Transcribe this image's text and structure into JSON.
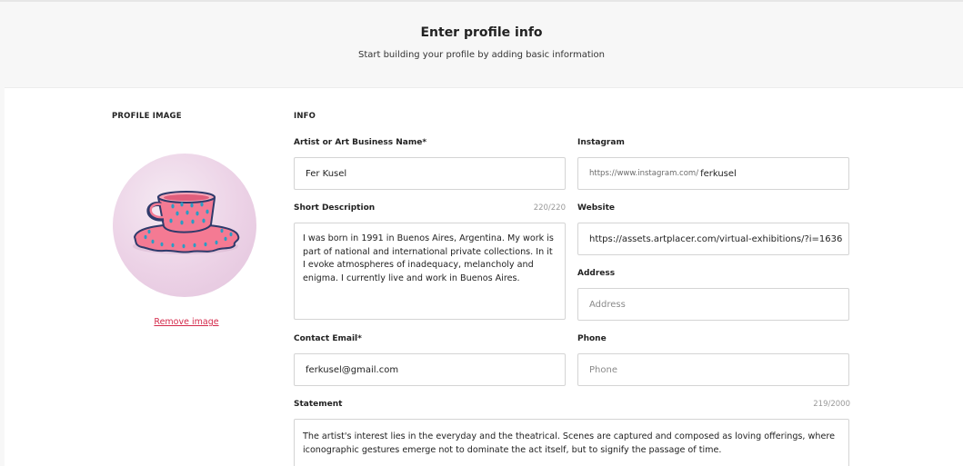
{
  "header": {
    "title": "Enter profile info",
    "subtitle": "Start building your profile by adding basic information"
  },
  "profile_image": {
    "heading": "PROFILE IMAGE",
    "remove_label": "Remove image"
  },
  "info": {
    "heading": "INFO",
    "artist_name": {
      "label": "Artist or Art Business Name*",
      "value": "Fer Kusel"
    },
    "instagram": {
      "label": "Instagram",
      "prefix": "https://www.instagram.com/",
      "value": "ferkusel"
    },
    "short_description": {
      "label": "Short Description",
      "counter": "220/220",
      "value": "I was born in 1991 in Buenos Aires, Argentina. My work is part of national and international private collections. In it I evoke atmospheres of inadequacy, melancholy and enigma. I currently live and work in Buenos Aires."
    },
    "website": {
      "label": "Website",
      "value": "https://assets.artplacer.com/virtual-exhibitions/?i=1636"
    },
    "address": {
      "label": "Address",
      "placeholder": "Address"
    },
    "contact_email": {
      "label": "Contact Email*",
      "value": "ferkusel@gmail.com"
    },
    "phone": {
      "label": "Phone",
      "placeholder": "Phone"
    },
    "statement": {
      "label": "Statement",
      "counter": "219/2000",
      "value": "The artist's interest lies in the everyday and the theatrical. Scenes are captured and composed as loving offerings, where iconographic gestures emerge not to dominate the act itself, but to signify the passage of time."
    }
  },
  "colors": {
    "background": "#f7f7f7",
    "card": "#ffffff",
    "border": "#d4d4d4",
    "link": "#d42a4b",
    "cup_pink": "#f47a93",
    "cup_dots": "#2a9dc4"
  },
  "icons": {
    "avatar_image": "teacup-illustration"
  }
}
